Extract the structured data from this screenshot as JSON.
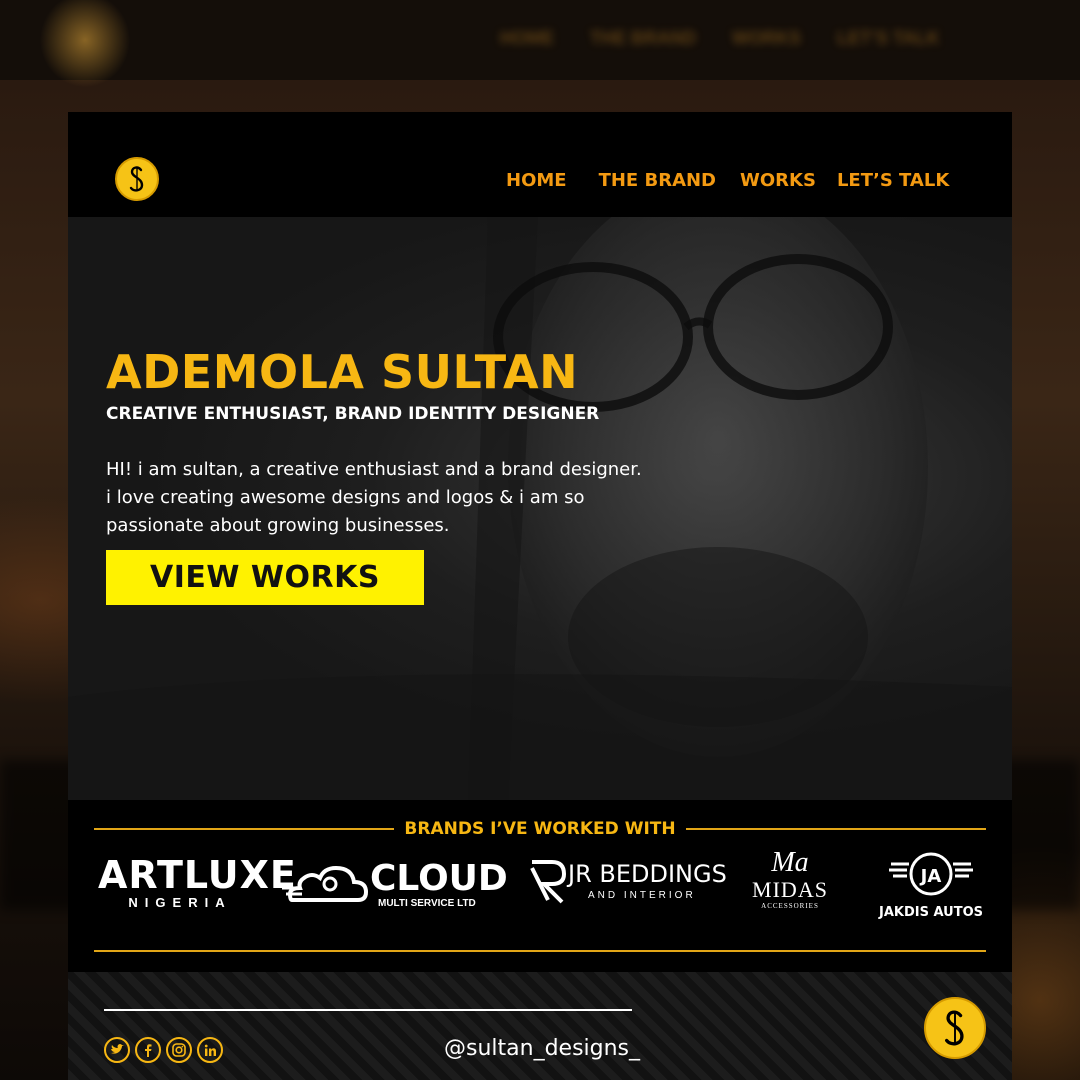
{
  "nav": {
    "items": [
      "HOME",
      "THE BRAND",
      "WORKS",
      "LET’S TALK"
    ]
  },
  "hero": {
    "name": "ADEMOLA SULTAN",
    "tagline": "CREATIVE ENTHUSIAST, BRAND IDENTITY DESIGNER",
    "bio_lines": [
      "HI! i am sultan, a creative enthusiast and a brand designer.",
      "i love creating awesome designs and logos & i am so",
      "passionate about growing businesses."
    ],
    "cta_label": "VIEW WORKS"
  },
  "brands": {
    "title": "BRANDS I’VE WORKED WITH",
    "items": [
      {
        "name": "ARTLUXE",
        "sub": "NIGERIA"
      },
      {
        "name": "CLOUD",
        "sub": "MULTI SERVICE LTD"
      },
      {
        "name": "JR BEDDINGS",
        "sub": "AND INTERIOR"
      },
      {
        "mark": "Ma",
        "name": "MIDAS",
        "sub": "ACCESSORIES"
      },
      {
        "mark": "JA",
        "name": "JAKDIS AUTOS"
      }
    ]
  },
  "footer": {
    "handle": "@sultan_designs_",
    "socials": [
      "twitter-icon",
      "facebook-icon",
      "instagram-icon",
      "linkedin-icon"
    ]
  },
  "colors": {
    "accent": "#f7b713",
    "cta": "#fff200",
    "background": "#000000"
  }
}
